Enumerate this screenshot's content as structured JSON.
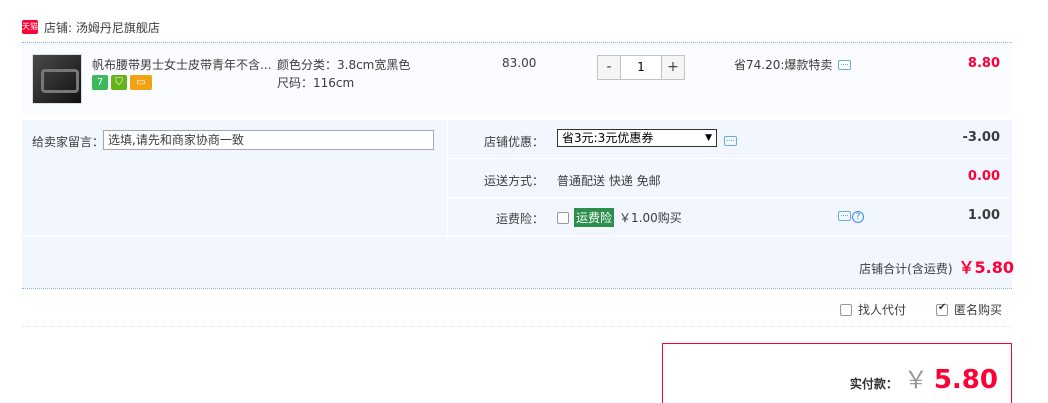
{
  "shop": {
    "badge": "天猫",
    "label": "店铺: 汤姆丹尼旗舰店"
  },
  "item": {
    "title": "帆布腰带男士女士皮带青年不含...",
    "badges": [
      "7",
      "",
      ""
    ],
    "sku_color": "颜色分类：3.8cm宽黑色",
    "sku_size": "尺码：116cm",
    "unit_price": "83.00",
    "qty_minus": "-",
    "qty": "1",
    "qty_plus": "+",
    "promo": "省74.20:爆款特卖",
    "subtotal": "8.80"
  },
  "message": {
    "label": "给卖家留言：",
    "placeholder": "选填,请先和商家协商一致"
  },
  "coupon": {
    "label": "店铺优惠：",
    "selected": "省3元:3元优惠券",
    "amount": "-3.00"
  },
  "shipping": {
    "label": "运送方式：",
    "value": "普通配送 快递 免邮",
    "amount": "0.00"
  },
  "insurance": {
    "label": "运费险：",
    "tag": "运费险",
    "value": "￥1.00购买",
    "amount": "1.00",
    "help": "?"
  },
  "shop_total": {
    "label": "店铺合计(含运费)",
    "value": "￥5.80"
  },
  "options": {
    "proxy_pay": "找人代付",
    "anonymous": "匿名购买"
  },
  "payment": {
    "label": "实付款：",
    "currency": "￥",
    "amount": "5.80"
  }
}
